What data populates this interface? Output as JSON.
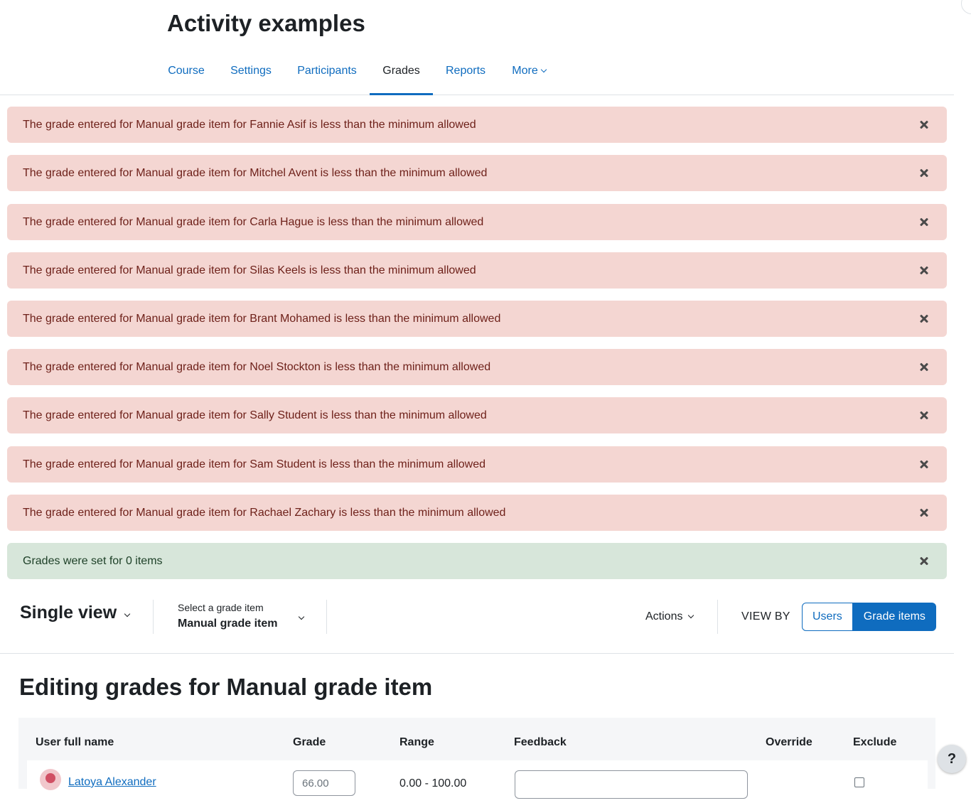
{
  "page": {
    "title": "Activity examples"
  },
  "nav": {
    "tabs": [
      {
        "label": "Course"
      },
      {
        "label": "Settings"
      },
      {
        "label": "Participants"
      },
      {
        "label": "Grades"
      },
      {
        "label": "Reports"
      },
      {
        "label": "More"
      }
    ],
    "active": "Grades"
  },
  "alerts": [
    {
      "type": "danger",
      "text": "The grade entered for Manual grade item for Fannie Asif is less than the minimum allowed"
    },
    {
      "type": "danger",
      "text": "The grade entered for Manual grade item for Mitchel Avent is less than the minimum allowed"
    },
    {
      "type": "danger",
      "text": "The grade entered for Manual grade item for Carla Hague is less than the minimum allowed"
    },
    {
      "type": "danger",
      "text": "The grade entered for Manual grade item for Silas Keels is less than the minimum allowed"
    },
    {
      "type": "danger",
      "text": "The grade entered for Manual grade item for Brant Mohamed is less than the minimum allowed"
    },
    {
      "type": "danger",
      "text": "The grade entered for Manual grade item for Noel Stockton is less than the minimum allowed"
    },
    {
      "type": "danger",
      "text": "The grade entered for Manual grade item for Sally Student is less than the minimum allowed"
    },
    {
      "type": "danger",
      "text": "The grade entered for Manual grade item for Sam Student is less than the minimum allowed"
    },
    {
      "type": "danger",
      "text": "The grade entered for Manual grade item for Rachael Zachary is less than the minimum allowed"
    },
    {
      "type": "success",
      "text": "Grades were set for 0 items"
    }
  ],
  "tertiary": {
    "report_title": "Single view",
    "selector_label": "Select a grade item",
    "selector_value": "Manual grade item",
    "actions_label": "Actions",
    "viewby_label": "VIEW BY",
    "users_button": "Users",
    "grade_items_button": "Grade items"
  },
  "editing_title": "Editing grades for Manual grade item",
  "table": {
    "headers": {
      "user": "User full name",
      "grade": "Grade",
      "range": "Range",
      "feedback": "Feedback",
      "override": "Override",
      "exclude": "Exclude"
    },
    "rows": [
      {
        "name": "Latoya Alexander",
        "grade": "66.00",
        "range": "0.00 - 100.00",
        "feedback": ""
      }
    ]
  },
  "help_button": "?",
  "colors": {
    "accent": "#0f6cbf",
    "danger_bg": "#f4d6d2",
    "danger_text": "#6e211a",
    "success_bg": "#d7e6da",
    "success_text": "#1c3f26"
  }
}
